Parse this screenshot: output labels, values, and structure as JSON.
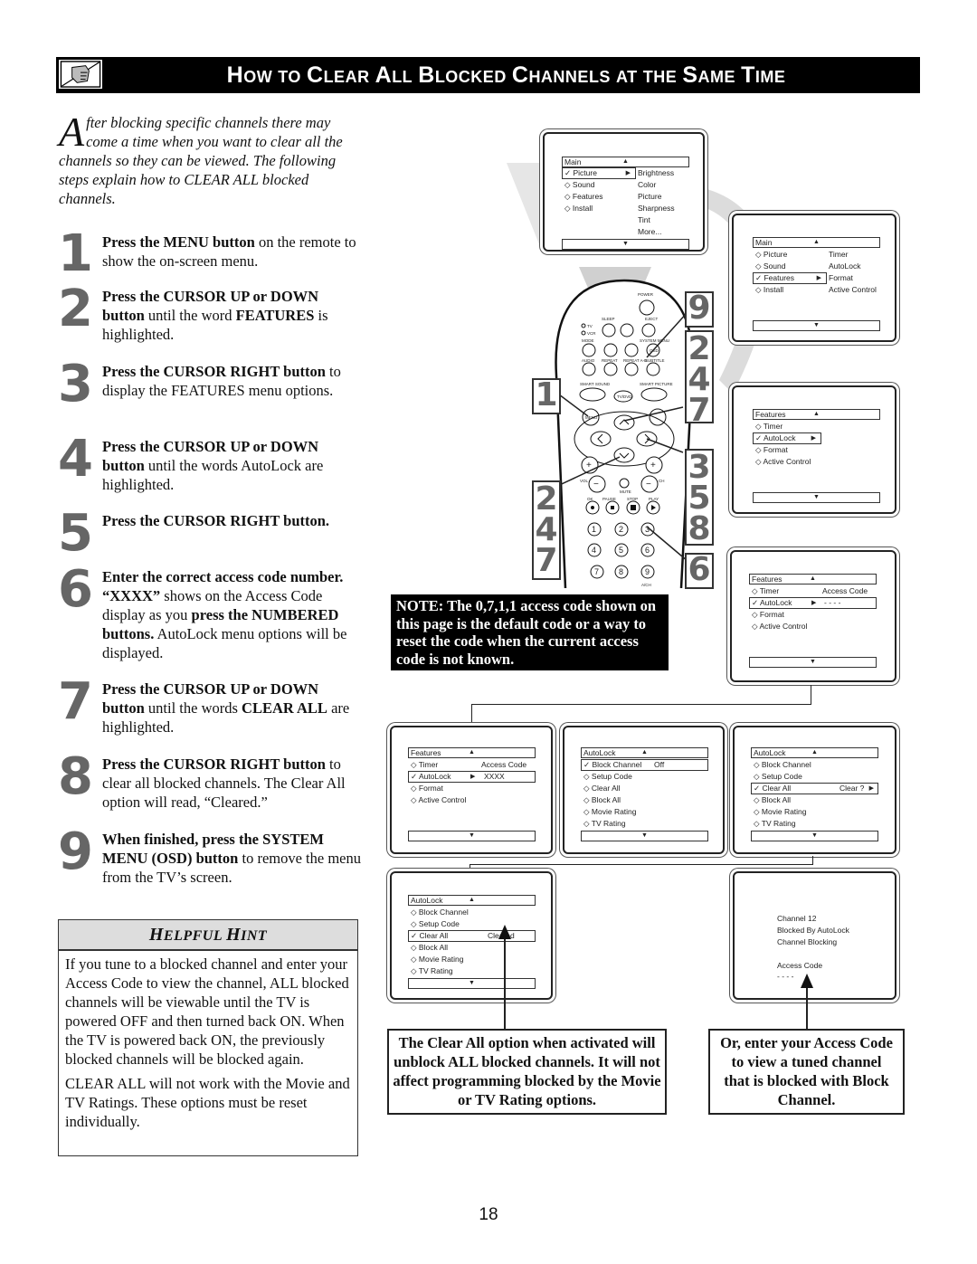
{
  "header": {
    "title": "How to Clear All Blocked Channels at the Same Time",
    "icon": "pencil-note-icon"
  },
  "intro": {
    "dropcap": "A",
    "text": "fter blocking specific channels there may come a time when you want to clear all the channels so they can be viewed. The following steps explain how to CLEAR ALL blocked channels."
  },
  "steps": [
    {
      "num": "1",
      "bold": "Press the MENU button",
      "rest": " on the remote to show the on-screen menu."
    },
    {
      "num": "2",
      "bold": "Press the CURSOR UP or DOWN button",
      "mid": " until the word ",
      "bold2": "FEATURES",
      "rest": " is highlighted."
    },
    {
      "num": "3",
      "bold": "Press the CURSOR RIGHT button",
      "rest": " to display the FEATURES menu options."
    },
    {
      "num": "4",
      "bold": "Press the CURSOR UP or DOWN button",
      "rest": " until the words AutoLock are highlighted."
    },
    {
      "num": "5",
      "bold": "Press the CURSOR RIGHT button.",
      "rest": ""
    },
    {
      "num": "6",
      "bold": "Enter the correct access code number. “XXXX”",
      "mid": " shows on the Access Code display as you ",
      "bold2": "press the NUMBERED buttons.",
      "rest": " AutoLock menu options will be displayed."
    },
    {
      "num": "7",
      "bold": "Press the CURSOR UP or DOWN button",
      "mid": " until the words ",
      "bold2": "CLEAR ALL",
      "rest": " are highlighted."
    },
    {
      "num": "8",
      "bold": "Press the CURSOR RIGHT button",
      "rest": " to clear all blocked channels. The Clear All option will read, “Cleared.”"
    },
    {
      "num": "9",
      "bold": "When finished, press the SYSTEM MENU (OSD) button",
      "rest": " to remove the menu from the TV’s screen."
    }
  ],
  "hint": {
    "title_first": "H",
    "title_rest1": "ELPFUL ",
    "title_h2": "H",
    "title_rest2": "INT",
    "p1": "If you tune to a blocked channel and enter your Access Code to view the channel, ALL blocked channels will be viewable until the TV is powered OFF and then turned back ON. When the TV is powered back ON, the previously blocked channels will be blocked again.",
    "p2": "CLEAR ALL will not work with the Movie and TV Ratings. These options must be reset individually."
  },
  "note": "NOTE: The 0,7,1,1 access code shown on this page is the default code or a way to reset the code when the current access code is not known.",
  "captions": {
    "clear_all": "The Clear All option when activated will unblock ALL blocked channels. It will not affect programming blocked by the Movie or TV Rating options.",
    "access_code": "Or, enter your Access Code to view a tuned channel that is blocked with Block Channel."
  },
  "callouts": {
    "top_right": [
      "9",
      "2",
      "4",
      "7"
    ],
    "left": [
      "1"
    ],
    "right_mid": [
      "3",
      "5",
      "8"
    ],
    "left_low": [
      "2",
      "4",
      "7"
    ],
    "right_low": [
      "6"
    ]
  },
  "remote": {
    "power": "POWER",
    "sleep": "SLEEP",
    "eject": "EJECT",
    "tv": "TV",
    "vcr": "VCR",
    "mode": "MODE",
    "system_menu": "SYSTEM MENU",
    "osd": "OSD",
    "audio": "AUDIO",
    "repeat": "REPEAT",
    "repeat_ab": "REPEAT A-B",
    "subtitle": "SUBTITLE",
    "smart_sound": "SMART SOUND",
    "smart_picture": "SMART PICTURE",
    "tvdvd": "TV/DVD",
    "menu": "MENU",
    "vol": "VOL",
    "ch": "CH",
    "mute": "MUTE",
    "ok": "OK",
    "pause": "PAUSE",
    "stop": "STOP",
    "play": "PLAY",
    "ach": "A/CH",
    "digits": [
      "1",
      "2",
      "3",
      "4",
      "5",
      "6",
      "7",
      "8",
      "9"
    ]
  },
  "screens": {
    "main1": {
      "title": "Main",
      "items": [
        "Picture",
        "Sound",
        "Features",
        "Install"
      ],
      "selected": 0,
      "sub": [
        "Brightness",
        "Color",
        "Picture",
        "Sharpness",
        "Tint",
        "More..."
      ]
    },
    "main2": {
      "title": "Main",
      "items": [
        "Picture",
        "Sound",
        "Features",
        "Install"
      ],
      "selected": 2,
      "sub": [
        "Timer",
        "AutoLock",
        "Format",
        "Active Control"
      ]
    },
    "features1": {
      "title": "Features",
      "items": [
        "Timer",
        "AutoLock",
        "Format",
        "Active Control"
      ],
      "selected": 1
    },
    "features2": {
      "title": "Features",
      "items": [
        "Timer",
        "AutoLock",
        "Format",
        "Active Control"
      ],
      "selected": 1,
      "label": "Access Code",
      "value": "- - - -"
    },
    "features3": {
      "title": "Features",
      "items": [
        "Timer",
        "AutoLock",
        "Format",
        "Active Control"
      ],
      "selected": 1,
      "label": "Access Code",
      "value": "XXXX"
    },
    "autolock1": {
      "title": "AutoLock",
      "items": [
        "Block Channel",
        "Setup Code",
        "Clear All",
        "Block All",
        "Movie Rating",
        "TV Rating"
      ],
      "selected": 0,
      "value": "Off"
    },
    "autolock2": {
      "title": "AutoLock",
      "items": [
        "Block Channel",
        "Setup Code",
        "Clear All",
        "Block All",
        "Movie Rating",
        "TV Rating"
      ],
      "selected": 2,
      "value": "Clear ?"
    },
    "autolock3": {
      "title": "AutoLock",
      "items": [
        "Block Channel",
        "Setup Code",
        "Clear All",
        "Block All",
        "Movie Rating",
        "TV Rating"
      ],
      "selected": 2,
      "value": "Cleared"
    },
    "blocked": {
      "lines": [
        "Channel 12",
        "Blocked By AutoLock",
        "Channel Blocking"
      ],
      "label": "Access Code",
      "value": "- - - -"
    }
  },
  "page_number": "18"
}
